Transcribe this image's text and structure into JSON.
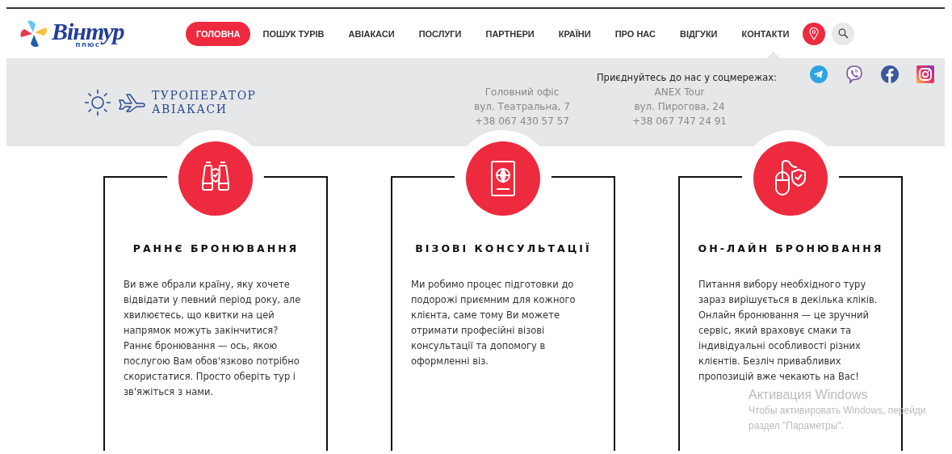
{
  "header": {
    "logo": {
      "name": "Вінтур",
      "sub": "плюс"
    },
    "nav": [
      {
        "label": "ГОЛОВНА",
        "selected": true
      },
      {
        "label": "ПОШУК ТУРІВ",
        "selected": false
      },
      {
        "label": "АВІАКАСИ",
        "selected": false
      },
      {
        "label": "ПОСЛУГИ",
        "selected": false
      },
      {
        "label": "ПАРТНЕРИ",
        "selected": false
      },
      {
        "label": "КРАЇНИ",
        "selected": false
      },
      {
        "label": "ПРО НАС",
        "selected": false
      },
      {
        "label": "ВІДГУКИ",
        "selected": false
      },
      {
        "label": "КОНТАКТИ",
        "selected": false
      }
    ],
    "tools": [
      {
        "kind": "location",
        "selected": true
      },
      {
        "kind": "search",
        "selected": false
      }
    ]
  },
  "info_bar": {
    "brand_lines": [
      "ТУРОПЕРАТОР",
      "АВІАКАСИ"
    ],
    "offices": [
      {
        "lines": [
          "Головний офіс",
          "вул. Театральна, 7",
          "+38 067 430 57 57"
        ]
      },
      {
        "lines": [
          "ANEX Tour",
          "вул. Пирогова, 24",
          "+38 067 747 24 91"
        ]
      }
    ],
    "social": {
      "title": "Приєднуйтесь до нас у соцмережах:",
      "networks": [
        {
          "kind": "telegram"
        },
        {
          "kind": "viber"
        },
        {
          "kind": "facebook"
        },
        {
          "kind": "instagram"
        }
      ]
    }
  },
  "cards": [
    {
      "kind": "binoculars",
      "title": "РАННЄ БРОНЮВАННЯ",
      "text": "Ви вже обрали країну, яку хочете відвідати у певний період року, але хвилюєтесь, що квитки на цей напрямок можуть закінчитися? Раннє бронювання — ось, якою послугою Вам обов'язково потрібно скористатися. Просто оберіть тур і зв'яжіться з нами."
    },
    {
      "kind": "passport",
      "title": "ВІЗОВІ КОНСУЛЬТАЦІЇ",
      "text": "Ми робимо процес підготовки до подорожі приємним для кожного клієнта, саме тому Ви можете отримати професійні візові консультації та допомогу в оформленні віз."
    },
    {
      "kind": "mouse",
      "title": "ОН-ЛАЙН БРОНЮВАННЯ",
      "text": "Питання вибору необхідного туру зараз вирішується в декілька кліків. Онлайн бронювання — це зручний сервіс, який враховує смаки та індивідуальні особливості різних клієнтів. Безліч привабливих пропозицій вже чекають на Вас!"
    }
  ],
  "os_notice": {
    "title": "Активация Windows",
    "lines": [
      "Чтобы активировать Windows, перейди",
      "раздел \"Параметры\"."
    ]
  }
}
